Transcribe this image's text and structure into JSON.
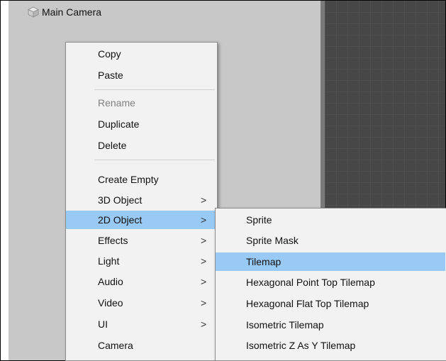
{
  "hierarchy": {
    "main_camera_label": "Main Camera",
    "icon": "cube-icon"
  },
  "context_menu": {
    "items": [
      {
        "label": "Copy"
      },
      {
        "label": "Paste"
      },
      {
        "label": "Rename",
        "disabled": true
      },
      {
        "label": "Duplicate"
      },
      {
        "label": "Delete"
      },
      {
        "label": "Create Empty"
      },
      {
        "label": "3D Object",
        "arrow": ">"
      },
      {
        "label": "2D Object",
        "arrow": ">",
        "highlighted": true
      },
      {
        "label": "Effects",
        "arrow": ">"
      },
      {
        "label": "Light",
        "arrow": ">"
      },
      {
        "label": "Audio",
        "arrow": ">"
      },
      {
        "label": "Video",
        "arrow": ">"
      },
      {
        "label": "UI",
        "arrow": ">"
      },
      {
        "label": "Camera"
      }
    ]
  },
  "submenu_2d_object": {
    "items": [
      {
        "label": "Sprite"
      },
      {
        "label": "Sprite Mask"
      },
      {
        "label": "Tilemap",
        "highlighted": true
      },
      {
        "label": "Hexagonal Point Top Tilemap"
      },
      {
        "label": "Hexagonal Flat Top Tilemap"
      },
      {
        "label": "Isometric Tilemap"
      },
      {
        "label": "Isometric Z As Y Tilemap"
      }
    ]
  },
  "colors": {
    "highlight": "#99c9f5",
    "menu_background": "#f2f2f2",
    "hierarchy_background": "#c8c8c8",
    "scene_background": "#474747"
  }
}
